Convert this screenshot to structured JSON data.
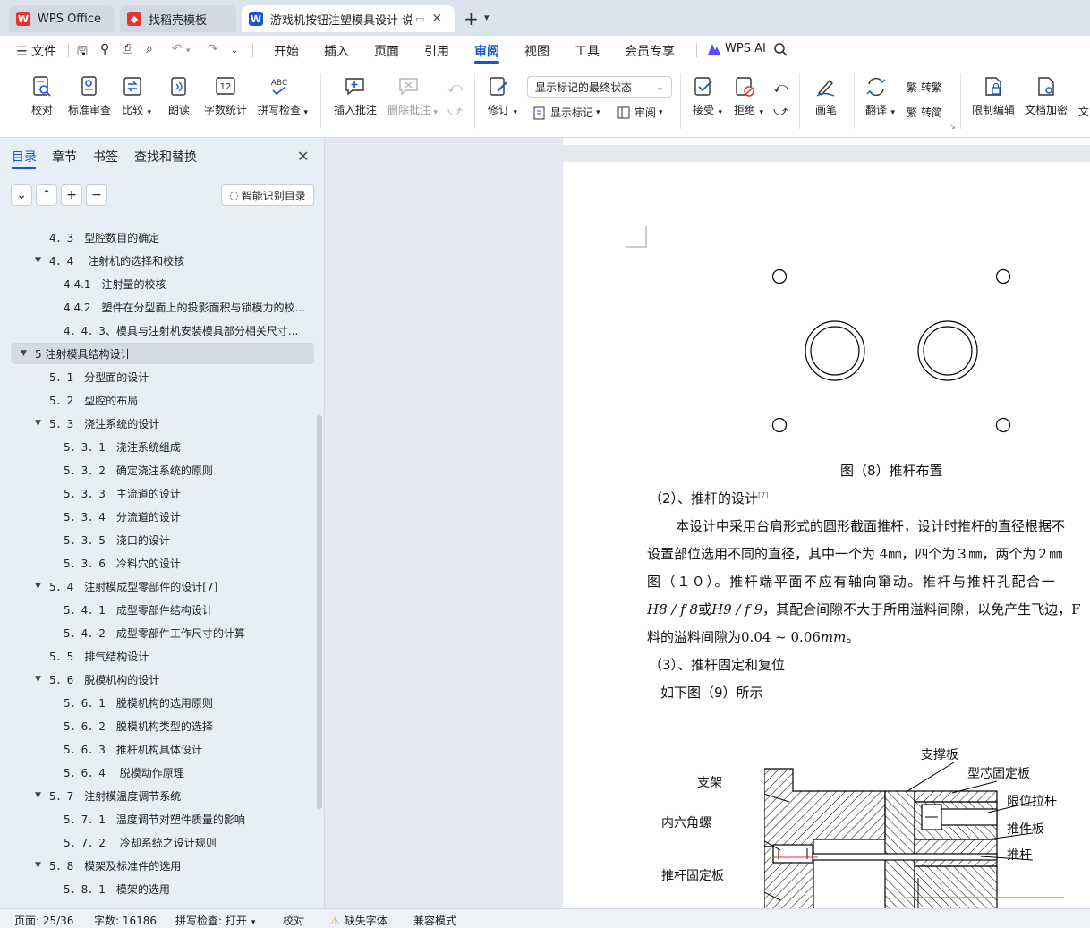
{
  "titlebar": {
    "tabs": [
      {
        "label": "WPS Office"
      },
      {
        "label": "找稻壳模板"
      },
      {
        "label": "游戏机按钮注塑模具设计 说明"
      }
    ]
  },
  "menubar": {
    "file_label": "文件",
    "items": [
      "开始",
      "插入",
      "页面",
      "引用",
      "审阅",
      "视图",
      "工具",
      "会员专享"
    ],
    "active": "审阅",
    "ai_label": "WPS AI"
  },
  "ribbon": {
    "proofread": "校对",
    "standard_review": "标准审查",
    "compare": "比较",
    "read_aloud": "朗读",
    "word_count": "字数统计",
    "spell_check": "拼写检查",
    "insert_comment": "插入批注",
    "delete_comment": "删除批注",
    "track_changes": "修订",
    "markup_state": "显示标记的最终状态",
    "show_markup": "显示标记",
    "review_pane": "审阅",
    "accept": "接受",
    "reject": "拒绝",
    "pen": "画笔",
    "translate": "翻译",
    "to_traditional": "转繁",
    "to_simplified": "转简",
    "restrict_edit": "限制编辑",
    "encrypt": "文档加密",
    "more": "文"
  },
  "sidebar": {
    "tabs": [
      "目录",
      "章节",
      "书签",
      "查找和替换"
    ],
    "smart_toc": "智能识别目录",
    "toc": [
      {
        "text": "4．3　型腔数目的确定",
        "level": 2,
        "arrow": false
      },
      {
        "text": "4．4　 注射机的选择和校核",
        "level": 2,
        "arrow": true
      },
      {
        "text": "4.4.1　注射量的校核",
        "level": 3,
        "arrow": false
      },
      {
        "text": "4.4.2　塑件在分型面上的投影面积与锁模力的校...",
        "level": 3,
        "arrow": false
      },
      {
        "text": "4．4．3、模具与注射机安装模具部分相关尺寸...",
        "level": 3,
        "arrow": false
      },
      {
        "text": "5 注射模具结构设计",
        "level": 1,
        "arrow": true,
        "selected": true
      },
      {
        "text": "5．1　分型面的设计",
        "level": 2,
        "arrow": false
      },
      {
        "text": "5．2　型腔的布局",
        "level": 2,
        "arrow": false
      },
      {
        "text": "5．3　浇注系统的设计",
        "level": 2,
        "arrow": true
      },
      {
        "text": "5．3．1　浇注系统组成",
        "level": 3,
        "arrow": false
      },
      {
        "text": "5．3．2　确定浇注系统的原则",
        "level": 3,
        "arrow": false
      },
      {
        "text": "5．3．3　主流道的设计",
        "level": 3,
        "arrow": false
      },
      {
        "text": "5．3．4　分流道的设计",
        "level": 3,
        "arrow": false
      },
      {
        "text": "5．3．5　浇口的设计",
        "level": 3,
        "arrow": false
      },
      {
        "text": "5．3．6　冷料穴的设计",
        "level": 3,
        "arrow": false
      },
      {
        "text": "5．4　注射模成型零部件的设计[7]",
        "level": 2,
        "arrow": true
      },
      {
        "text": "5．4．1　成型零部件结构设计",
        "level": 3,
        "arrow": false
      },
      {
        "text": "5．4．2　成型零部件工作尺寸的计算",
        "level": 3,
        "arrow": false
      },
      {
        "text": "5．5　排气结构设计",
        "level": 2,
        "arrow": false
      },
      {
        "text": "5．6　脱模机构的设计",
        "level": 2,
        "arrow": true
      },
      {
        "text": "5．6．1　脱模机构的选用原则",
        "level": 3,
        "arrow": false
      },
      {
        "text": "5．6．2　脱模机构类型的选择",
        "level": 3,
        "arrow": false
      },
      {
        "text": "5．6．3　推杆机构具体设计",
        "level": 3,
        "arrow": false
      },
      {
        "text": "5．6．4　 脱模动作原理",
        "level": 3,
        "arrow": false
      },
      {
        "text": "5．7　注射模温度调节系统",
        "level": 2,
        "arrow": true
      },
      {
        "text": "5．7．1　温度调节对塑件质量的影响",
        "level": 3,
        "arrow": false
      },
      {
        "text": "5．7．2　 冷却系统之设计规则",
        "level": 3,
        "arrow": false
      },
      {
        "text": "5．8　模架及标准件的选用",
        "level": 2,
        "arrow": true
      },
      {
        "text": "5．8．1　模架的选用",
        "level": 3,
        "arrow": false
      }
    ]
  },
  "document": {
    "figure8_caption": "图（8）推杆布置",
    "heading2": "（2）、推杆的设计",
    "heading2_sup": "[7]",
    "para1": "本设计中采用台肩形式的圆形截面推杆，设计时推杆的直径根据不",
    "para2": "设置部位选用不同的直径，其中一个为 4㎜，四个为３㎜，两个为２㎜",
    "para3": "图（１０）。推杆端平面不应有轴向窜动。推杆与推杆孔配合一",
    "para4a": "H8 / f 8",
    "para4b": "或",
    "para4c": "H9 / f 9",
    "para4d": "，其配合间隙不大于所用溢料间隙，以免产生飞边，F",
    "para5a": "料的溢料间隙为",
    "para5b": "0.04 ~ 0.06",
    "para5c": "mm",
    "para5d": "。",
    "heading3": "（3）、推杆固定和复位",
    "para6": "如下图（9）所示",
    "figure9_labels": {
      "zhicheng": "支撑板",
      "xingxin": "型芯固定板",
      "zhijia": "支架",
      "xianwei": "限位拉杆",
      "neiliujiao": "内六角螺",
      "tuijianban": "推件板",
      "tuigan": "推杆",
      "tuiganguding": "推杆固定板"
    }
  },
  "statusbar": {
    "page": "页面: 25/36",
    "words": "字数: 16186",
    "spell": "拼写检查: 打开",
    "proof": "校对",
    "missing_font": "缺失字体",
    "compat": "兼容模式"
  },
  "colors": {
    "accent": "#1656d6",
    "wps_red": "#e8322e"
  }
}
